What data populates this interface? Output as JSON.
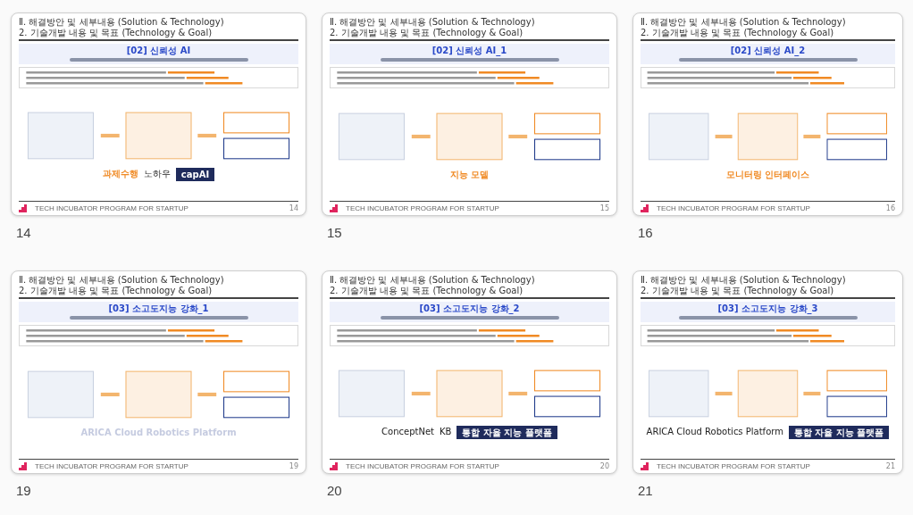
{
  "slides": [
    {
      "number": "14",
      "header": "Ⅱ. 해결방안 및 세부내용 (Solution & Technology)",
      "subheader": "2. 기술개발 내용 및 목표 (Technology & Goal)",
      "section_title": "[02] 신뢰성 AI",
      "footer": "TECH INCUBATOR PROGRAM FOR STARTUP",
      "page": "14",
      "selected": false,
      "labels": [
        {
          "text": "과제수행",
          "kind": "accent"
        },
        {
          "text": "노하우",
          "kind": "plain"
        },
        {
          "text": "capAI",
          "kind": "navy"
        }
      ]
    },
    {
      "number": "15",
      "header": "Ⅱ. 해결방안 및 세부내용 (Solution & Technology)",
      "subheader": "2. 기술개발 내용 및 목표 (Technology & Goal)",
      "section_title": "[02] 신뢰성 AI_1",
      "footer": "TECH INCUBATOR PROGRAM FOR STARTUP",
      "page": "15",
      "selected": false,
      "labels": [
        {
          "text": "지능 모델",
          "kind": "accent"
        }
      ]
    },
    {
      "number": "16",
      "header": "Ⅱ. 해결방안 및 세부내용 (Solution & Technology)",
      "subheader": "2. 기술개발 내용 및 목표 (Technology & Goal)",
      "section_title": "[02] 신뢰성 AI_2",
      "footer": "TECH INCUBATOR PROGRAM FOR STARTUP",
      "page": "16",
      "selected": false,
      "labels": [
        {
          "text": "모니터링 인터페이스",
          "kind": "accent"
        }
      ]
    },
    {
      "number": "19",
      "header": "Ⅱ. 해결방안 및 세부내용 (Solution & Technology)",
      "subheader": "2. 기술개발 내용 및 목표 (Technology & Goal)",
      "section_title": "[03] 소고도지능 강화_1",
      "footer": "TECH INCUBATOR PROGRAM FOR STARTUP",
      "page": "19",
      "selected": false,
      "labels": [
        {
          "text": "ARICA Cloud Robotics Platform",
          "kind": "faded"
        }
      ]
    },
    {
      "number": "20",
      "header": "Ⅱ. 해결방안 및 세부내용 (Solution & Technology)",
      "subheader": "2. 기술개발 내용 및 목표 (Technology & Goal)",
      "section_title": "[03] 소고도지능 강화_2",
      "footer": "TECH INCUBATOR PROGRAM FOR STARTUP",
      "page": "20",
      "selected": false,
      "labels": [
        {
          "text": "ConceptNet",
          "kind": "plain"
        },
        {
          "text": "KB",
          "kind": "plain"
        },
        {
          "text": "통합 자율 지능 플랫폼",
          "kind": "navy"
        }
      ]
    },
    {
      "number": "21",
      "header": "Ⅱ. 해결방안 및 세부내용 (Solution & Technology)",
      "subheader": "2. 기술개발 내용 및 목표 (Technology & Goal)",
      "section_title": "[03] 소고도지능 강화_3",
      "footer": "TECH INCUBATOR PROGRAM FOR STARTUP",
      "page": "21",
      "selected": false,
      "labels": [
        {
          "text": "ARICA Cloud Robotics Platform",
          "kind": "plain"
        },
        {
          "text": "통합 자율 지능 플랫폼",
          "kind": "navy"
        }
      ]
    }
  ]
}
